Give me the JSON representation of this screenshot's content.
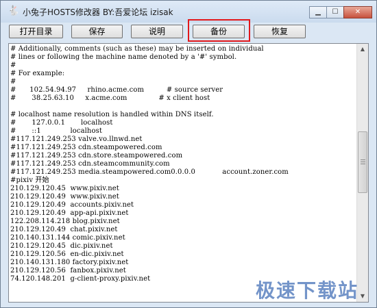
{
  "window": {
    "title": "小兔子HOSTS修改器 BY:吾爱论坛 izisak",
    "caption_buttons": {
      "minimize": "▁",
      "maximize": "☐",
      "close": "✕"
    }
  },
  "toolbar": {
    "open_dir": "打开目录",
    "save": "保存",
    "help": "说明",
    "backup": "备份",
    "restore": "恢复"
  },
  "editor_lines": [
    "# Additionally, comments (such as these) may be inserted on individual",
    "# lines or following the machine name denoted by a '#' symbol.",
    "#",
    "# For example:",
    "#",
    "#      102.54.94.97     rhino.acme.com          # source server",
    "#       38.25.63.10     x.acme.com              # x client host",
    "",
    "# localhost name resolution is handled within DNS itself.",
    "#       127.0.0.1       localhost",
    "#       ::1             localhost",
    "#117.121.249.253 valve.vo.llnwd.net",
    "#117.121.249.253 cdn.steampowered.com",
    "#117.121.249.253 cdn.store.steampowered.com",
    "#117.121.249.253 cdn.steamcommunity.com",
    "#117.121.249.253 media.steampowered.com0.0.0.0            account.zoner.com",
    "#pixiv 开始",
    "210.129.120.45  www.pixiv.net",
    "210.129.120.49  www.pixiv.net",
    "210.129.120.49  accounts.pixiv.net",
    "210.129.120.49  app-api.pixiv.net",
    "122.208.114.218 blog.pixiv.net",
    "210.129.120.49  chat.pixiv.net",
    "210.140.131.144 comic.pixiv.net",
    "210.129.120.45  dic.pixiv.net",
    "210.129.120.56  en-dic.pixiv.net",
    "210.140.131.180 factory.pixiv.net",
    "210.129.120.56  fanbox.pixiv.net",
    "74.120.148.201  g-client-proxy.pixiv.net"
  ],
  "watermark": "极速下载站",
  "colors": {
    "highlight": "#e3171a",
    "watermark": "#5b82c0"
  }
}
